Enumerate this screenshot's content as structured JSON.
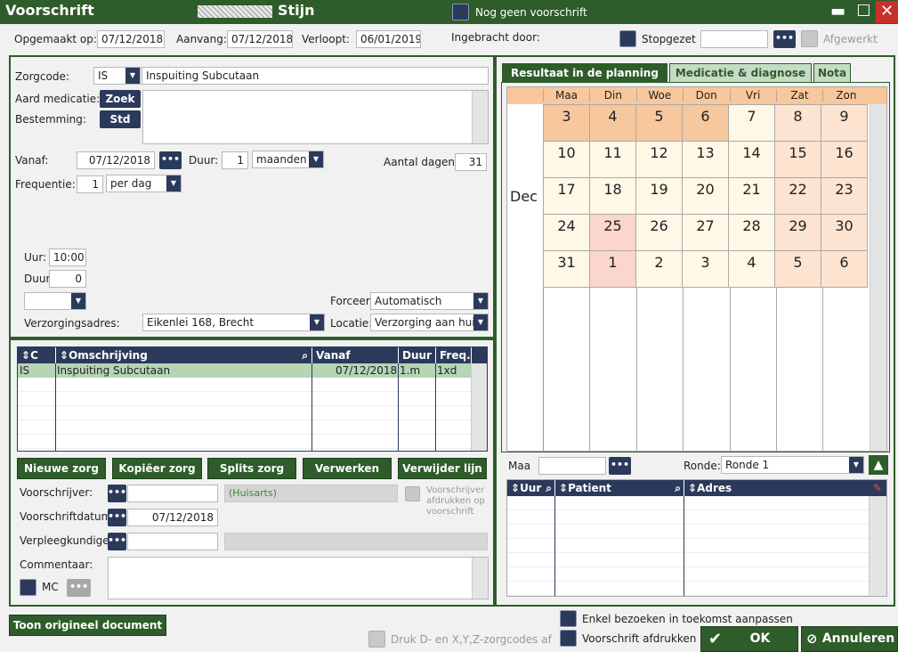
{
  "window": {
    "title": "Voorschrift",
    "patient": "Stijn",
    "no_prescription": "Nog geen voorschrift",
    "minimize": "▬",
    "maximize": "☐",
    "close": "✕"
  },
  "header": {
    "opgemaakt_label": "Opgemaakt op:",
    "opgemaakt_value": "07/12/2018",
    "aanvang_label": "Aanvang:",
    "aanvang_value": "07/12/2018",
    "verloopt_label": "Verloopt:",
    "verloopt_value": "06/01/2019",
    "ingebracht_label": "Ingebracht door:",
    "stopgezet_label": "Stopgezet",
    "stopgezet_value": "",
    "afgewerkt_label": "Afgewerkt",
    "dots": "•••"
  },
  "form": {
    "zorgcode_label": "Zorgcode:",
    "zorgcode_value": "IS",
    "zorgcode_desc": "Inspuiting Subcutaan",
    "aard_label": "Aard medicatie:",
    "zoek_label": "Zoek",
    "bestemming_label": "Bestemming:",
    "std_label": "Std",
    "vanaf_label": "Vanaf:",
    "vanaf_value": "07/12/2018",
    "duur_label": "Duur:",
    "duur_value": "1",
    "duur_unit": "maanden",
    "aantal_label": "Aantal dagen:",
    "aantal_value": "31",
    "freq_label": "Frequentie:",
    "freq_value": "1",
    "freq_unit": "per dag",
    "uur_label": "Uur:",
    "uur_value": "10:00",
    "duur2_label": "Duur",
    "duur2_value": "0",
    "forceer_label": "Forceer",
    "forceer_value": "Automatisch",
    "adres_label": "Verzorgingsadres:",
    "adres_value": "Eikenlei 168, Brecht",
    "locatie_label": "Locatie:",
    "locatie_value": "Verzorging aan huis"
  },
  "table": {
    "headers": [
      "C",
      "Omschrijving",
      "Vanaf",
      "Duur",
      "Freq."
    ],
    "rows": [
      [
        "IS",
        "Inspuiting Subcutaan",
        "07/12/2018",
        "1.m",
        "1xd"
      ]
    ]
  },
  "buttons": {
    "nieuwe": "Nieuwe zorg",
    "kopieer": "Kopiëer zorg",
    "splits": "Splits zorg",
    "verwerken": "Verwerken",
    "verwijder": "Verwijder lijn"
  },
  "prescriber": {
    "voorschrijver_label": "Voorschrijver:",
    "huisarts": "(Huisarts)",
    "afdrukken_label": "Voorschrijver afdrukken op voorschrift",
    "datum_label": "Voorschriftdatum",
    "datum_value": "07/12/2018",
    "verpleeg_label": "Verpleegkundige:",
    "commentaar_label": "Commentaar:",
    "mc_label": "MC"
  },
  "tabs": [
    "Resultaat in de planning",
    "Medicatie & diagnose",
    "Nota"
  ],
  "calendar": {
    "days": [
      "Maa",
      "Din",
      "Woe",
      "Don",
      "Vri",
      "Zat",
      "Zon"
    ],
    "month": "Dec",
    "weeks": [
      [
        "3",
        "4",
        "5",
        "6",
        "7",
        "8",
        "9"
      ],
      [
        "10",
        "11",
        "12",
        "13",
        "14",
        "15",
        "16"
      ],
      [
        "17",
        "18",
        "19",
        "20",
        "21",
        "22",
        "23"
      ],
      [
        "24",
        "25",
        "26",
        "27",
        "28",
        "29",
        "30"
      ],
      [
        "31",
        "1",
        "2",
        "3",
        "4",
        "5",
        "6"
      ]
    ]
  },
  "planning": {
    "maa_label": "Maa",
    "ronde_label": "Ronde:",
    "ronde_value": "Ronde 1",
    "headers": [
      "Uur",
      "Patient",
      "Adres"
    ]
  },
  "footer": {
    "toon": "Toon origineel document",
    "druk": "Druk D- en X,Y,Z-zorgcodes af",
    "enkel": "Enkel bezoeken in toekomst aanpassen",
    "afdrukken": "Voorschrift afdrukken",
    "ok": "OK",
    "annuleren": "Annuleren"
  }
}
